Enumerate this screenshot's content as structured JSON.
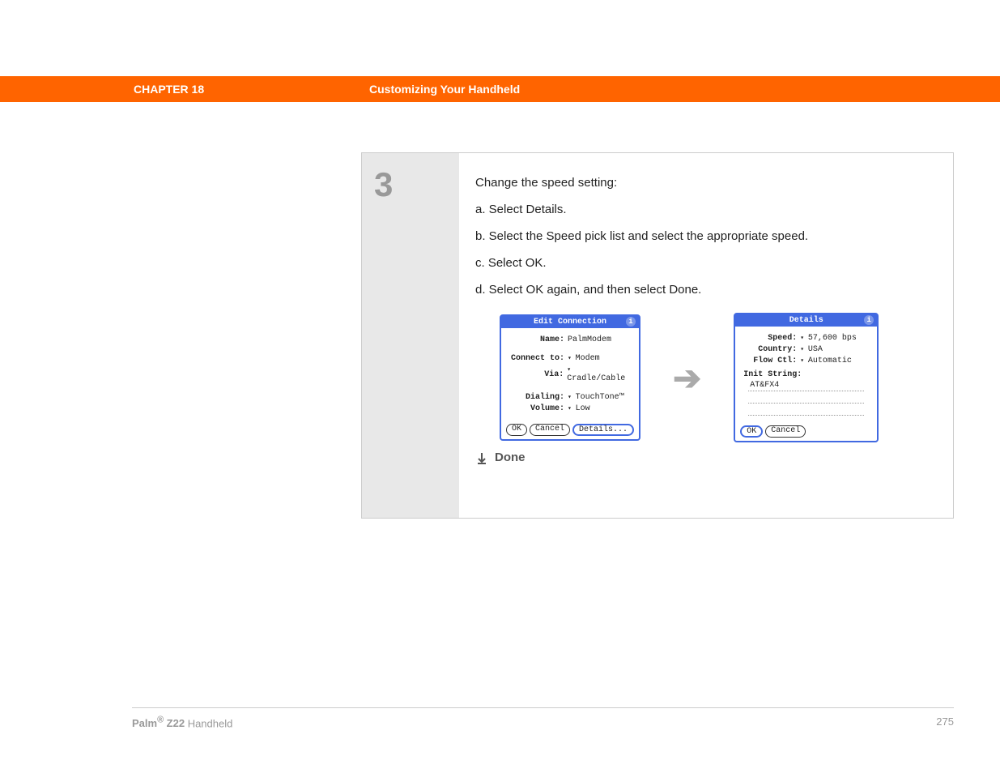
{
  "header": {
    "chapter": "CHAPTER 18",
    "title": "Customizing Your Handheld"
  },
  "step": {
    "number": "3",
    "intro": "Change the speed setting:",
    "substeps": [
      "a.  Select Details.",
      "b.  Select the Speed pick list and select the appropriate speed.",
      "c.  Select OK.",
      "d.  Select OK again, and then select Done."
    ],
    "done_label": "Done"
  },
  "dialog_edit": {
    "title": "Edit Connection",
    "rows": {
      "name_label": "Name:",
      "name_value": "PalmModem",
      "connect_label": "Connect to:",
      "connect_value": "Modem",
      "via_label": "Via:",
      "via_value": "Cradle/Cable",
      "dialing_label": "Dialing:",
      "dialing_value": "TouchTone™",
      "volume_label": "Volume:",
      "volume_value": "Low"
    },
    "buttons": {
      "ok": "OK",
      "cancel": "Cancel",
      "details": "Details..."
    }
  },
  "dialog_details": {
    "title": "Details",
    "rows": {
      "speed_label": "Speed:",
      "speed_value": "57,600 bps",
      "country_label": "Country:",
      "country_value": "USA",
      "flow_label": "Flow Ctl:",
      "flow_value": "Automatic"
    },
    "init_label": "Init String:",
    "init_value": "AT&FX4",
    "buttons": {
      "ok": "OK",
      "cancel": "Cancel"
    }
  },
  "footer": {
    "product_bold": "Palm",
    "product_sup": "®",
    "product_model": " Z22 ",
    "product_type": "Handheld",
    "page": "275"
  }
}
